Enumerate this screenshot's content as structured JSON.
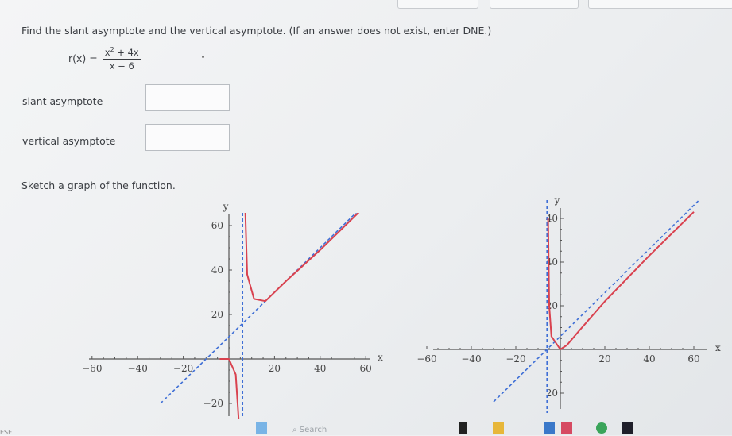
{
  "question": {
    "prompt": "Find the slant asymptote and the vertical asymptote. (If an answer does not exist, enter DNE.)",
    "function_name": "r(x) =",
    "numerator_base": "x",
    "numerator_exp": "2",
    "numerator_rest": " + 4x",
    "denominator": "x − 6"
  },
  "fields": {
    "slant_label": "slant asymptote",
    "slant_value": "",
    "vertical_label": "vertical asymptote",
    "vertical_value": ""
  },
  "sketch_prompt": "Sketch a graph of the function.",
  "taskbar": {
    "search_placeholder": "Search",
    "corner_text": "ESE"
  },
  "colors": {
    "curve": "#d9424f",
    "asymptote": "#3f6fd6",
    "axis": "#555555"
  },
  "chart_data": [
    {
      "type": "line",
      "title": "",
      "xlabel": "x",
      "ylabel": "y",
      "xlim": [
        -66,
        66
      ],
      "ylim": [
        -24,
        64
      ],
      "x_ticks": [
        -60,
        -40,
        -20,
        20,
        40,
        60
      ],
      "x_tick_labels": [
        "−60",
        "−40",
        "−20",
        "20",
        "40",
        "60"
      ],
      "y_ticks": [
        -20,
        20,
        40,
        60
      ],
      "y_tick_labels": [
        "−20",
        "20",
        "40",
        "60"
      ],
      "vertical_asymptote_x": 6,
      "slant_asymptote": {
        "slope": 1,
        "intercept": 10
      },
      "series": [
        {
          "points": [
            [
              -4,
              0
            ],
            [
              0,
              0
            ],
            [
              3,
              -7
            ],
            [
              5,
              -39
            ]
          ]
        },
        {
          "points": [
            [
              6.5,
              90
            ],
            [
              8,
              38
            ],
            [
              11,
              27
            ],
            [
              16,
              26
            ],
            [
              25,
              35
            ],
            [
              40,
              49
            ],
            [
              60,
              69
            ]
          ]
        }
      ]
    },
    {
      "type": "line",
      "title": "",
      "xlabel": "x",
      "ylabel": "y",
      "xlim": [
        -60,
        60
      ],
      "ylim": [
        -20,
        40
      ],
      "x_ticks": [
        -60,
        -40,
        -20,
        20,
        40,
        60
      ],
      "x_tick_labels": [
        "−60",
        "−40",
        "−20",
        "20",
        "40",
        "60"
      ],
      "y_ticks": [
        -20,
        20,
        40,
        60
      ],
      "y_tick_labels": [
        "20",
        "20",
        "40",
        "40"
      ],
      "vertical_asymptote_x": -6,
      "slant_asymptote": {
        "slope": 1,
        "intercept": 6
      },
      "series": [
        {
          "points": [
            [
              -5.5,
              60
            ],
            [
              -5,
              20
            ],
            [
              -4,
              6
            ],
            [
              0,
              0
            ],
            [
              3,
              2
            ],
            [
              8,
              8
            ],
            [
              20,
              22
            ],
            [
              40,
              43
            ],
            [
              60,
              63
            ]
          ]
        }
      ]
    }
  ]
}
